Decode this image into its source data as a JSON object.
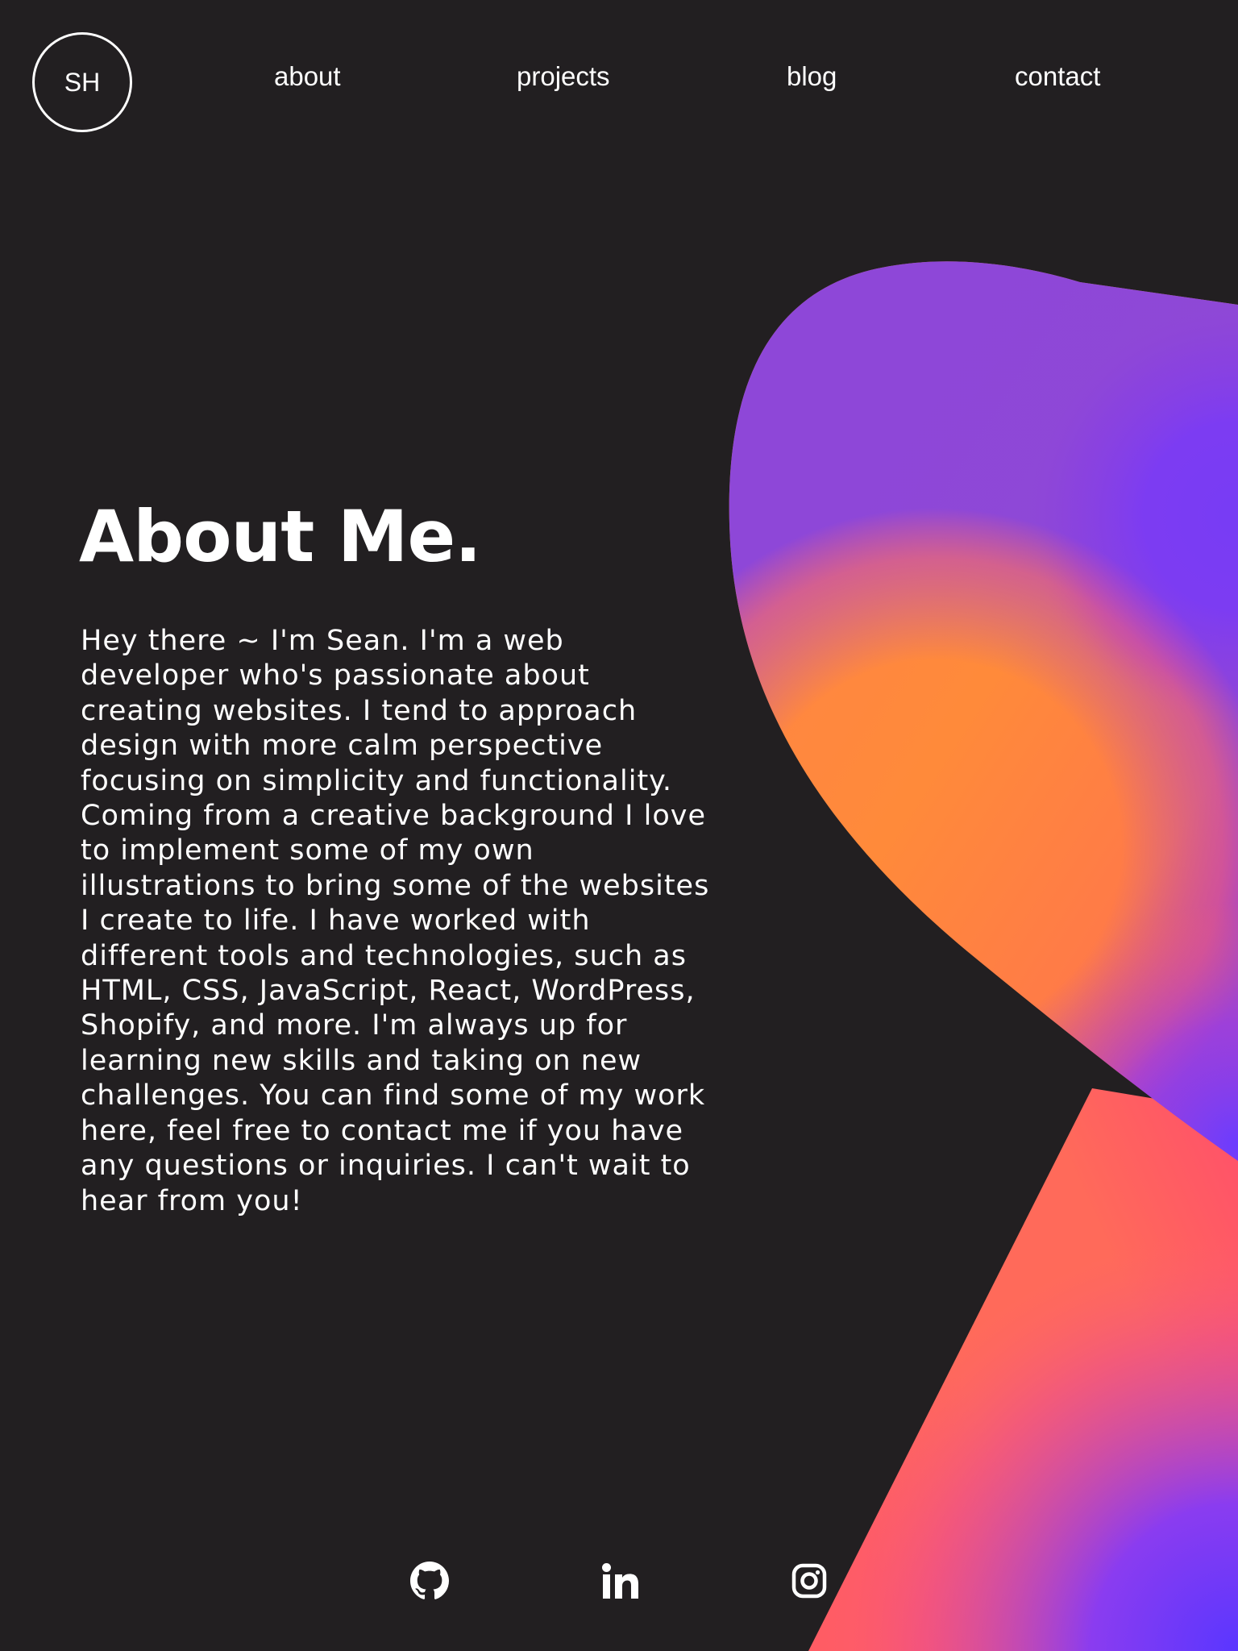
{
  "logo": {
    "initials": "SH"
  },
  "nav": {
    "about": "about",
    "projects": "projects",
    "blog": "blog",
    "contact": "contact"
  },
  "about": {
    "title": "About Me.",
    "body": "Hey there ~ I'm Sean. I'm a web developer who's passionate about creating websites. I tend to approach design with more calm perspective focusing on simplicity and functionality. Coming from a creative background I love to implement some of my own illustrations to bring some of the websites I create to life. I have worked with different tools and technologies, such as HTML, CSS, JavaScript, React, WordPress, Shopify, and more. I'm always up for learning new skills and taking on new challenges. You can find some of my work here, feel free to contact me if you have any questions or inquiries. I can't wait to hear from you!"
  },
  "social": [
    {
      "icon": "github-icon"
    },
    {
      "icon": "linkedin-icon"
    },
    {
      "icon": "instagram-icon"
    }
  ],
  "colors": {
    "background": "#221f21",
    "text": "#ffffff",
    "blob_orange": "#ff8a3a",
    "blob_coral": "#ff6160",
    "blob_purple": "#6a3cff"
  }
}
